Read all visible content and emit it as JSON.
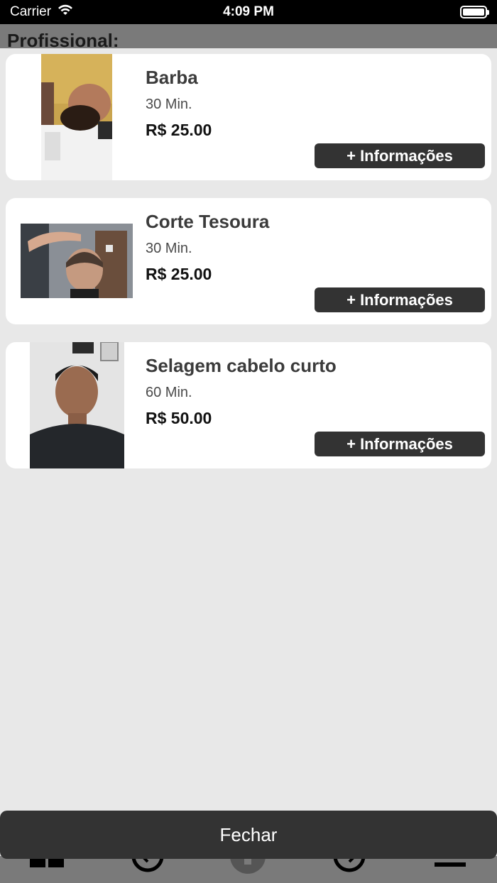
{
  "status_bar": {
    "carrier": "Carrier",
    "time": "4:09 PM"
  },
  "header": {
    "title": "Profissional:"
  },
  "services": [
    {
      "name": "Barba",
      "duration": "30 Min.",
      "price": "R$ 25.00",
      "info_label": "+ Informações"
    },
    {
      "name": "Corte Tesoura",
      "duration": "30 Min.",
      "price": "R$ 25.00",
      "info_label": "+ Informações"
    },
    {
      "name": "Selagem cabelo curto",
      "duration": "60 Min.",
      "price": "R$ 50.00",
      "info_label": "+ Informações"
    }
  ],
  "close_button": {
    "label": "Fechar"
  },
  "colors": {
    "background": "#e8e8e8",
    "button_dark": "#333333",
    "header_gray": "#7a7a7a"
  }
}
